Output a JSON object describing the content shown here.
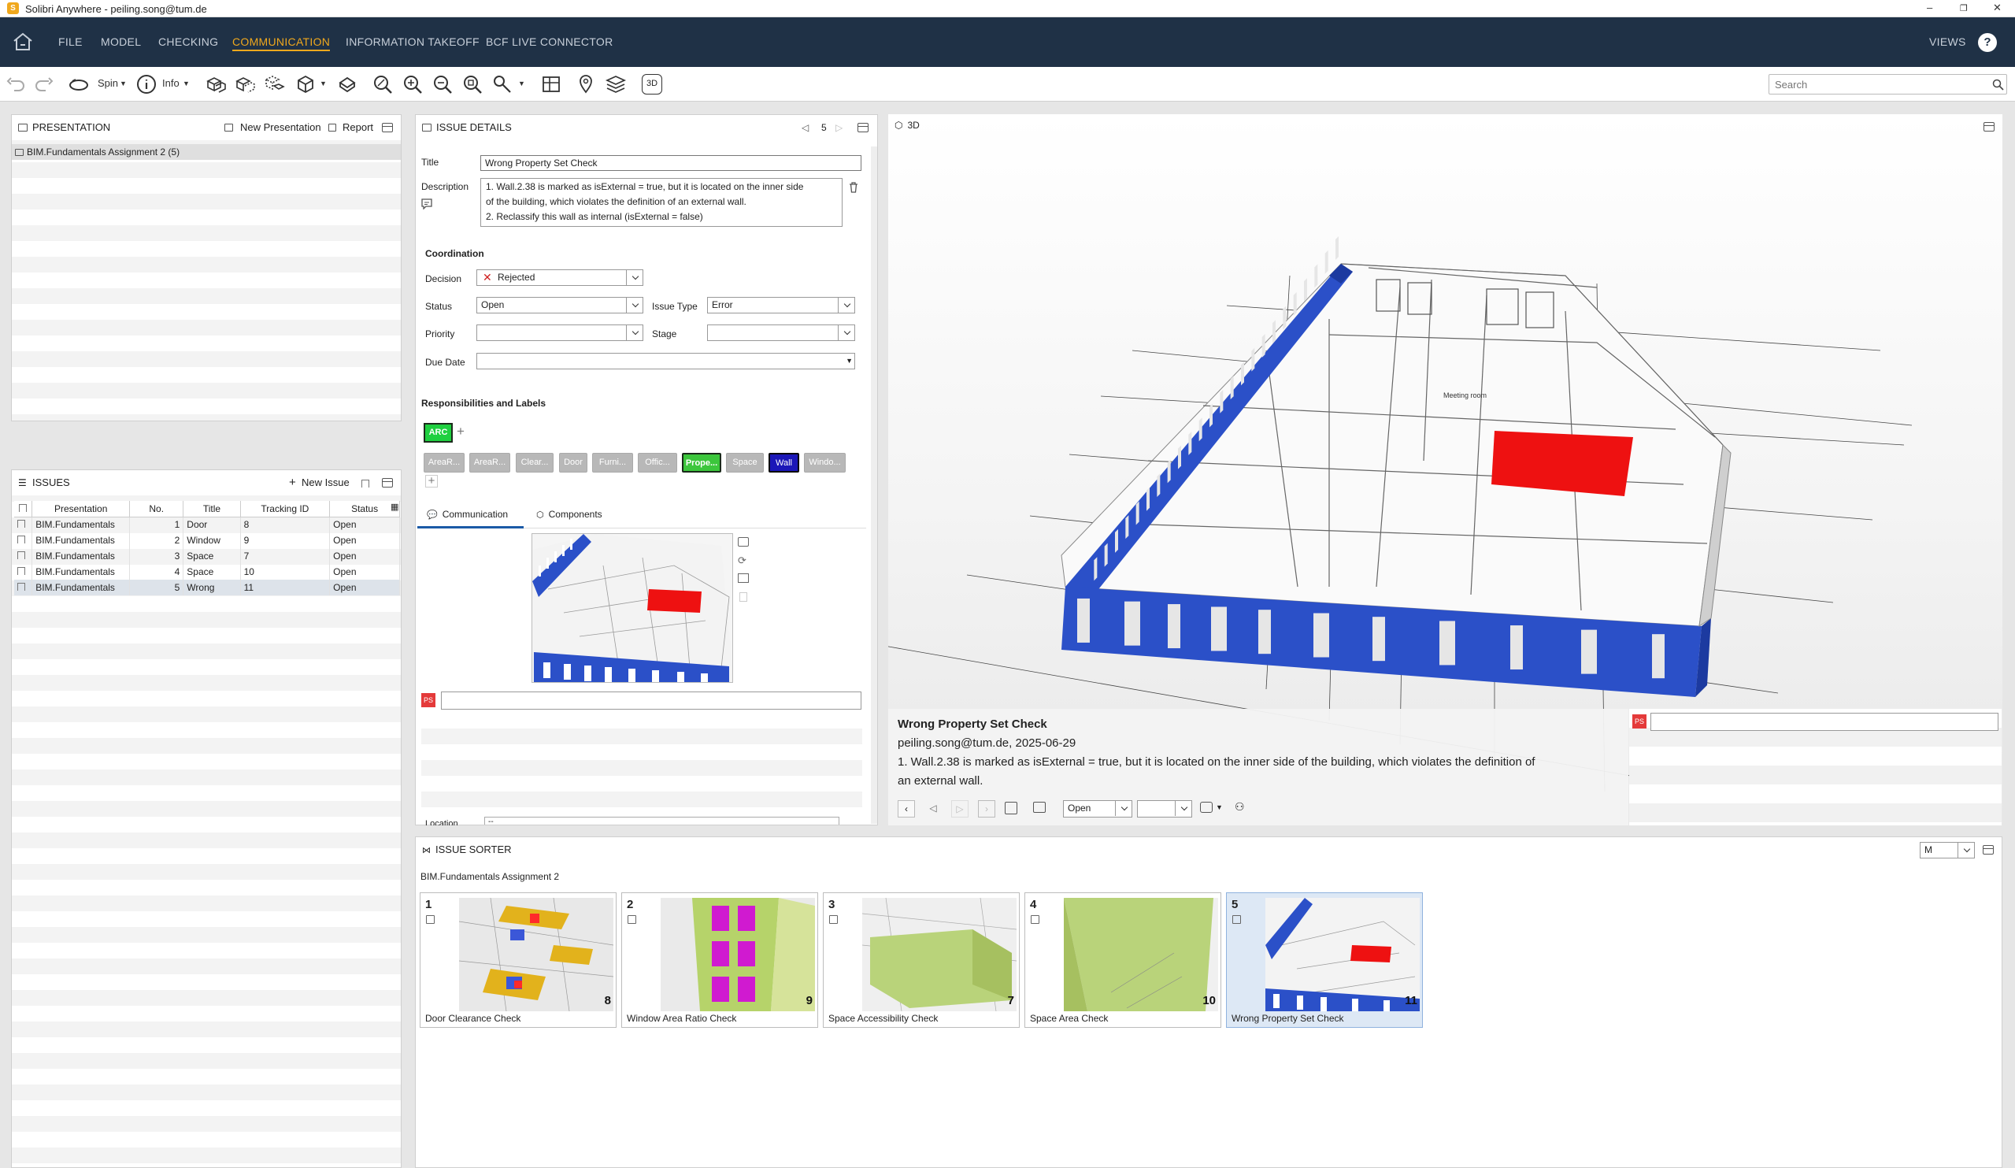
{
  "window": {
    "title": "Solibri Anywhere - peiling.song@tum.de"
  },
  "menu": {
    "items": [
      "FILE",
      "MODEL",
      "CHECKING",
      "COMMUNICATION",
      "INFORMATION TAKEOFF",
      "BCF LIVE CONNECTOR"
    ],
    "active": "COMMUNICATION",
    "views": "VIEWS",
    "help": "?"
  },
  "toolbar": {
    "spin": "Spin",
    "info": "Info",
    "view_3d": "3D"
  },
  "search": {
    "placeholder": "Search"
  },
  "presentation": {
    "header": "PRESENTATION",
    "new_presentation": "New Presentation",
    "report": "Report",
    "item": "BIM.Fundamentals Assignment 2 (5)"
  },
  "issues": {
    "header": "ISSUES",
    "new_issue": "New Issue",
    "columns": [
      "Presentation",
      "No.",
      "Title",
      "Tracking ID",
      "Status"
    ],
    "rows": [
      {
        "presentation": "BIM.Fundamentals",
        "no": "1",
        "title": "Door",
        "tracking": "8",
        "status": "Open"
      },
      {
        "presentation": "BIM.Fundamentals",
        "no": "2",
        "title": "Window",
        "tracking": "9",
        "status": "Open"
      },
      {
        "presentation": "BIM.Fundamentals",
        "no": "3",
        "title": "Space",
        "tracking": "7",
        "status": "Open"
      },
      {
        "presentation": "BIM.Fundamentals",
        "no": "4",
        "title": "Space",
        "tracking": "10",
        "status": "Open"
      },
      {
        "presentation": "BIM.Fundamentals",
        "no": "5",
        "title": "Wrong",
        "tracking": "11",
        "status": "Open"
      }
    ]
  },
  "details": {
    "header": "ISSUE DETAILS",
    "page": "5",
    "title_label": "Title",
    "title_value": "Wrong Property Set Check",
    "desc_label": "Description",
    "desc_lines": [
      "1. Wall.2.38 is marked as isExternal = true, but it is located on the inner side",
      "of the building, which violates the definition of an external wall.",
      "2. Reclassify this wall as internal (isExternal = false)"
    ],
    "coordination": "Coordination",
    "decision_label": "Decision",
    "decision_value": "Rejected",
    "status_label": "Status",
    "status_value": "Open",
    "issue_type_label": "Issue Type",
    "issue_type_value": "Error",
    "priority_label": "Priority",
    "priority_value": "",
    "stage_label": "Stage",
    "stage_value": "",
    "due_label": "Due Date",
    "due_value": "",
    "resp_label": "Responsibilities and Labels",
    "resp_tag": "ARC",
    "labels": [
      "AreaR...",
      "AreaR...",
      "Clear...",
      "Door",
      "Furni...",
      "Offic...",
      "Prope...",
      "Space",
      "Wall",
      "Windo..."
    ],
    "tab_comm": "Communication",
    "tab_comp": "Components",
    "avatar": "PS",
    "location_label": "Location",
    "location_value": "--"
  },
  "viewer": {
    "header": "3D",
    "popup_title": "Wrong Property Set Check",
    "popup_meta": "peiling.song@tum.de, 2025-06-29",
    "popup_text_1": "1. Wall.2.38 is marked as isExternal = true, but it is located on the inner side of the building, which violates the definition of",
    "popup_text_2": "an external wall.",
    "popup_status": "Open",
    "popup_second": "",
    "avatar": "PS",
    "room_label": "Meeting room"
  },
  "sorter": {
    "header": "ISSUE SORTER",
    "subtitle": "BIM.Fundamentals Assignment 2",
    "size": "M",
    "cards": [
      {
        "num": "1",
        "count": "8",
        "caption": "Door Clearance Check"
      },
      {
        "num": "2",
        "count": "9",
        "caption": "Window Area Ratio Check"
      },
      {
        "num": "3",
        "count": "7",
        "caption": "Space Accessibility Check"
      },
      {
        "num": "4",
        "count": "10",
        "caption": "Space Area Check"
      },
      {
        "num": "5",
        "count": "11",
        "caption": "Wrong Property Set Check"
      }
    ]
  },
  "colors": {
    "menubar": "#1f3146",
    "accent": "#f0a81d",
    "wall_blue": "#2b50c8",
    "issue_red": "#ee1111",
    "tag_green": "#1fd040",
    "tag_wall": "#1b17b8"
  }
}
